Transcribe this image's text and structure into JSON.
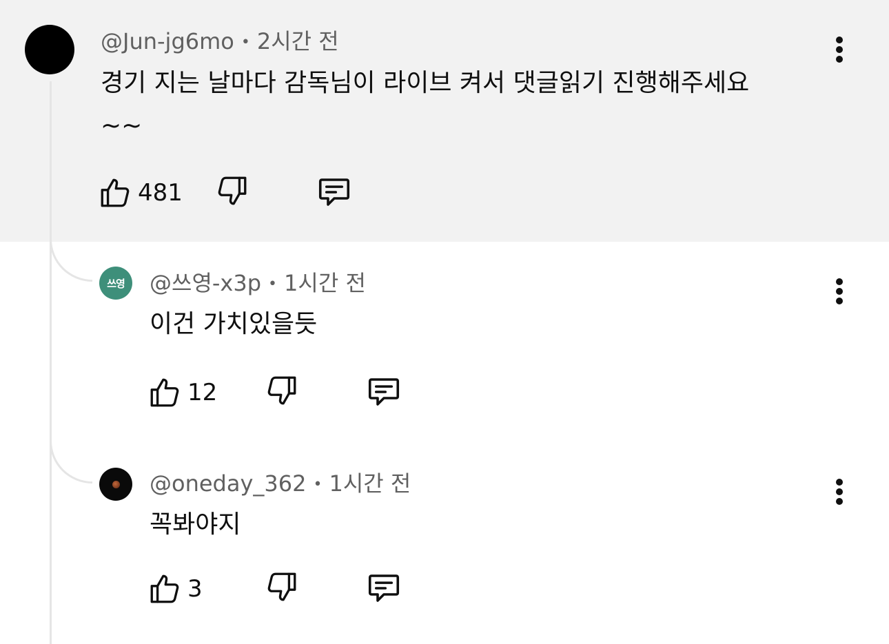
{
  "main_comment": {
    "author": "@Jun-jg6mo",
    "time": "2시간 전",
    "text": "경기 지는 날마다 감독님이 라이브 켜서 댓글읽기 진행해주세요\n~~",
    "likes": "481"
  },
  "replies": [
    {
      "author": "@쓰영-x3p",
      "time": "1시간 전",
      "text": "이건 가치있을듯",
      "likes": "12",
      "avatar_text": "쓰영",
      "avatar_color": "#3e8f7a"
    },
    {
      "author": "@oneday_362",
      "time": "1시간 전",
      "text": "꼭봐야지",
      "likes": "3"
    }
  ],
  "icons": {
    "like": "thumbs-up-icon",
    "dislike": "thumbs-down-icon",
    "reply": "comment-icon",
    "more": "more-vertical-icon"
  },
  "colors": {
    "highlight_bg": "#f2f2f2",
    "meta_text": "#606060",
    "thread_line": "#e5e5e5"
  }
}
